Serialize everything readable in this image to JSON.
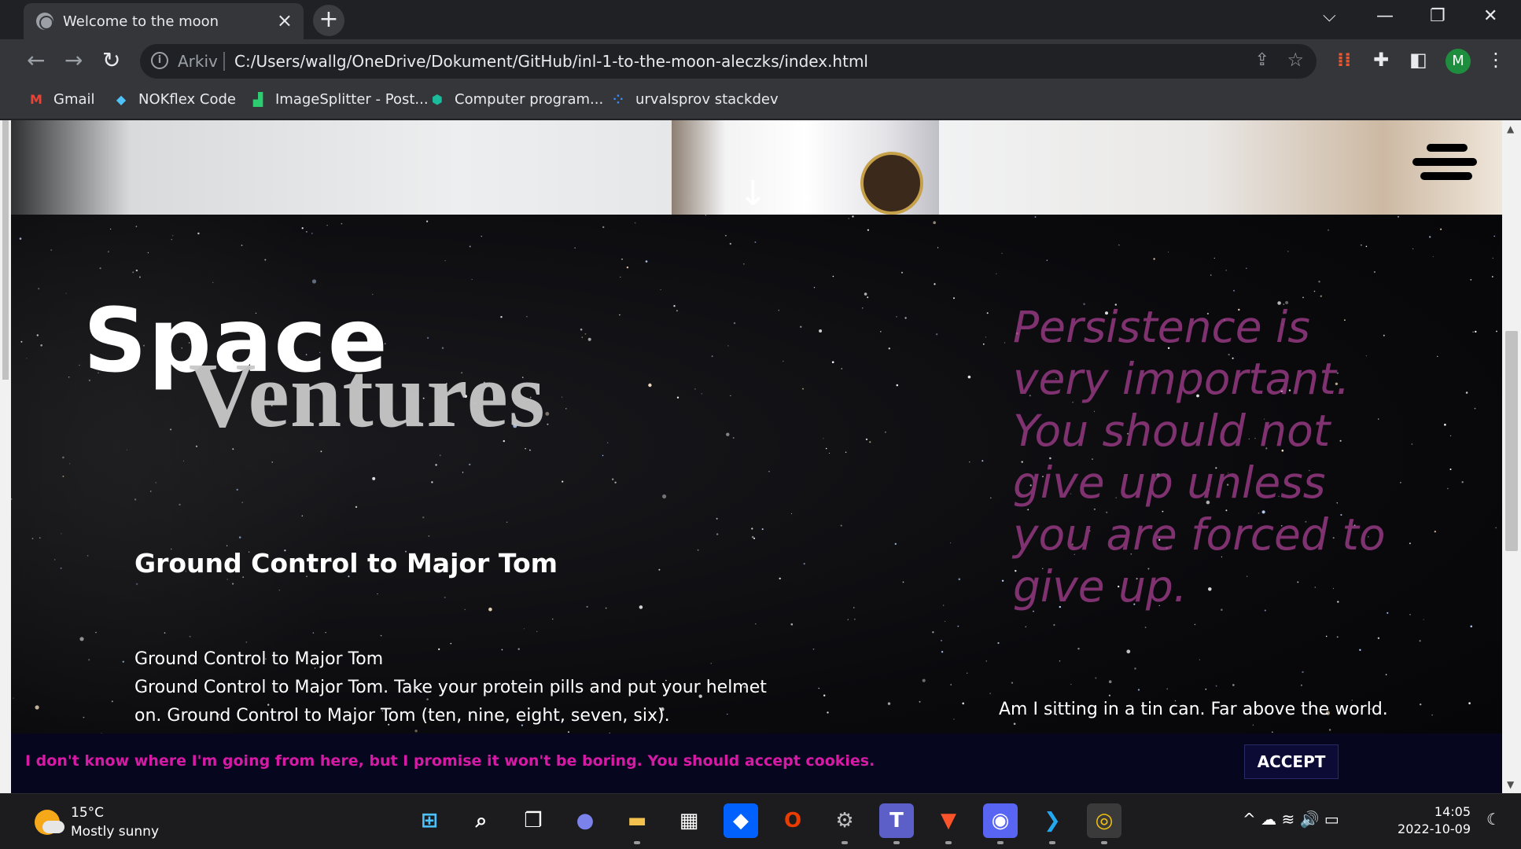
{
  "browser": {
    "tab_title": "Welcome to the moon",
    "tab_close": "×",
    "new_tab": "+",
    "window_controls": {
      "dropdown": "⌵",
      "minimize": "—",
      "restore": "❐",
      "close": "✕"
    },
    "nav": {
      "back": "←",
      "forward": "→",
      "reload": "↻"
    },
    "address": {
      "info": "i",
      "scheme_label": "Arkiv",
      "url": "C:/Users/wallg/OneDrive/Dokument/GitHub/inl-1-to-the-moon-aleczks/index.html"
    },
    "profile_initial": "M",
    "bookmarks": [
      {
        "label": "Gmail",
        "icon": "gmail-icon"
      },
      {
        "label": "NOKflex Code",
        "icon": "diamond-icon"
      },
      {
        "label": "ImageSplitter - Post...",
        "icon": "imagesplitter-icon"
      },
      {
        "label": "Computer program...",
        "icon": "shield-icon"
      },
      {
        "label": "urvalsprov stackdev",
        "icon": "dots-icon"
      }
    ]
  },
  "page": {
    "down_arrow": "↓",
    "logo": {
      "word1": "Space",
      "word2": "Ventures"
    },
    "quote": "Persistence is very important. You should not give up unless you are forced to give up.",
    "heading": "Ground Control to Major Tom",
    "paragraph_lines": [
      "Ground Control to Major Tom",
      "Ground Control to Major Tom. Take your protein pills and put your helmet on. Ground Control to Major Tom (ten, nine, eight, seven, six)."
    ],
    "lyric": "Am I sitting in a tin can. Far above the world.",
    "cookie": {
      "message": "I don't know where I'm going from here, but I promise it won't be boring. You should accept cookies.",
      "accept_label": "ACCEPT"
    },
    "colors": {
      "quote": "#9a3b86",
      "cookie_text": "#d61aa5",
      "cookie_bg": "#06061f"
    }
  },
  "taskbar": {
    "weather": {
      "temp": "15°C",
      "condition": "Mostly sunny"
    },
    "apps": [
      {
        "name": "start-icon",
        "glyph": "⊞",
        "color": "#4cc2ff",
        "bg": "transparent",
        "dot": false
      },
      {
        "name": "search-icon",
        "glyph": "⌕",
        "color": "#ffffff",
        "bg": "transparent",
        "dot": false
      },
      {
        "name": "task-view-icon",
        "glyph": "❐",
        "color": "#ffffff",
        "bg": "transparent",
        "dot": false
      },
      {
        "name": "chat-icon",
        "glyph": "●",
        "color": "#7b83eb",
        "bg": "transparent",
        "dot": false
      },
      {
        "name": "file-explorer-icon",
        "glyph": "▬",
        "color": "#f2c14e",
        "bg": "transparent",
        "dot": true
      },
      {
        "name": "store-icon",
        "glyph": "▦",
        "color": "#ffffff",
        "bg": "transparent",
        "dot": false
      },
      {
        "name": "dropbox-icon",
        "glyph": "◆",
        "color": "#ffffff",
        "bg": "#0061fe",
        "dot": false
      },
      {
        "name": "office-icon",
        "glyph": "O",
        "color": "#eb3c00",
        "bg": "transparent",
        "dot": false
      },
      {
        "name": "settings-icon",
        "glyph": "⚙",
        "color": "#c0c0c0",
        "bg": "transparent",
        "dot": true
      },
      {
        "name": "teams-icon",
        "glyph": "T",
        "color": "#ffffff",
        "bg": "#5b5fc7",
        "dot": true
      },
      {
        "name": "brave-icon",
        "glyph": "▼",
        "color": "#fb542b",
        "bg": "transparent",
        "dot": true
      },
      {
        "name": "discord-icon",
        "glyph": "◉",
        "color": "#ffffff",
        "bg": "#5865f2",
        "dot": true
      },
      {
        "name": "vscode-icon",
        "glyph": "❯",
        "color": "#23a9f2",
        "bg": "transparent",
        "dot": true
      },
      {
        "name": "chrome-icon",
        "glyph": "◎",
        "color": "#f4c20d",
        "bg": "#3a3a3a",
        "dot": true
      }
    ],
    "tray": "^  ☁  ≋  🔊  ▭",
    "time": "14:05",
    "date": "2022-10-09",
    "notifications": "☾"
  }
}
